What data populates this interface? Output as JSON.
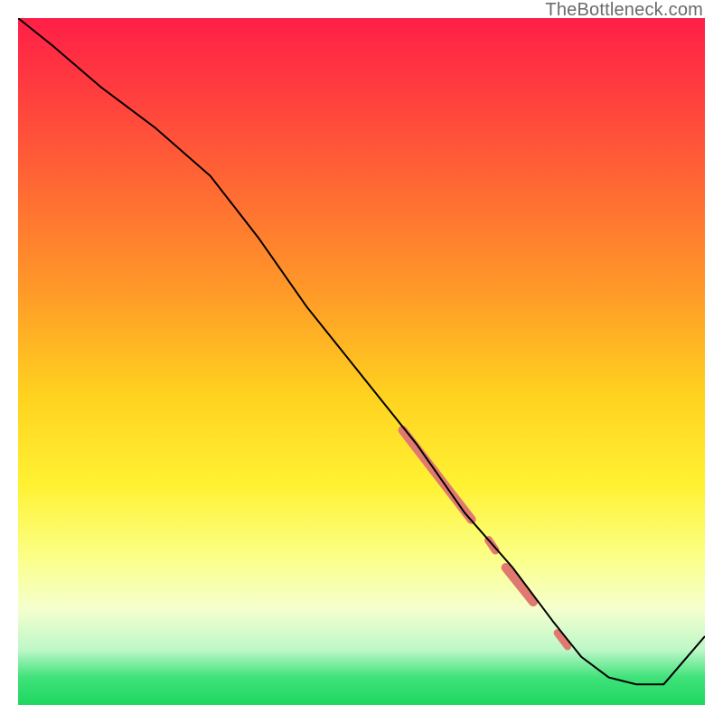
{
  "watermark": "TheBottleneck.com",
  "chart_data": {
    "type": "line",
    "title": "",
    "xlabel": "",
    "ylabel": "",
    "xlim": [
      0,
      100
    ],
    "ylim": [
      0,
      100
    ],
    "grid": false,
    "legend": false,
    "series": [
      {
        "name": "curve",
        "color": "#000000",
        "x": [
          0,
          5,
          12,
          20,
          28,
          35,
          42,
          50,
          58,
          65,
          72,
          78,
          82,
          86,
          90,
          94,
          100
        ],
        "y": [
          100,
          96,
          90,
          84,
          77,
          68,
          58,
          48,
          38,
          28,
          20,
          12,
          7,
          4,
          3,
          3,
          10
        ]
      }
    ],
    "highlight_segments": [
      {
        "name": "band-1",
        "x0": 56,
        "y0": 40,
        "x1": 66,
        "y1": 27,
        "width": 10
      },
      {
        "name": "band-2",
        "x0": 71,
        "y0": 20,
        "x1": 75,
        "y1": 15,
        "width": 10
      },
      {
        "name": "dot-1",
        "x0": 68.5,
        "y0": 24,
        "x1": 69.5,
        "y1": 22.5,
        "width": 9
      },
      {
        "name": "dot-2",
        "x0": 78.5,
        "y0": 10.5,
        "x1": 80,
        "y1": 8.5,
        "width": 8
      }
    ],
    "highlight_color": "#e0796f"
  }
}
